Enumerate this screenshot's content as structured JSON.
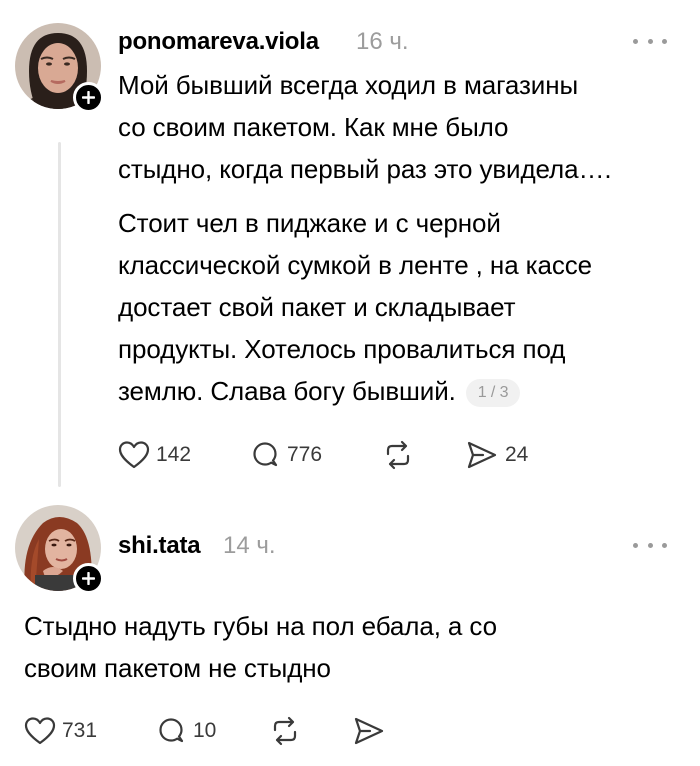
{
  "colors": {
    "text": "#000000",
    "muted": "#9c9c9c",
    "thread_line": "#e5e5e5",
    "badge_bg": "#f1f1f1"
  },
  "post": {
    "username": "ponomareva.viola",
    "time": "16 ч.",
    "lines_1": [
      "Мой бывший всегда ходил в магазины",
      "со своим пакетом. Как мне было",
      "стыдно, когда первый раз это увидела…."
    ],
    "lines_2": [
      "Стоит чел в пиджаке и с черной",
      "классической сумкой в ленте , на кассе",
      "достает свой пакет и складывает",
      "продукты. Хотелось провалиться под",
      "землю. Слава богу бывший."
    ],
    "page_indicator": "1 / 3",
    "likes": "142",
    "replies": "776",
    "reposts": "",
    "shares": "24",
    "icons": [
      "avatar",
      "plus-icon",
      "more-icon",
      "heart-icon",
      "comment-icon",
      "repost-icon",
      "share-icon"
    ]
  },
  "reply": {
    "username": "shi.tata",
    "time": "14 ч.",
    "lines": [
      "Стыдно надуть губы на пол ебала, а со",
      "своим пакетом не стыдно"
    ],
    "likes": "731",
    "replies": "10",
    "icons": [
      "avatar",
      "plus-icon",
      "more-icon",
      "heart-icon",
      "comment-icon",
      "repost-icon",
      "share-icon"
    ]
  }
}
